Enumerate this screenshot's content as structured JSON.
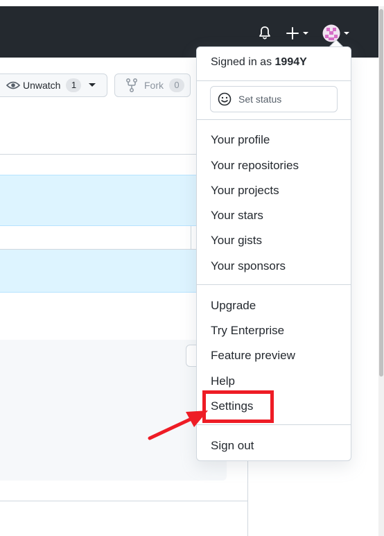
{
  "header": {
    "bell_icon": "bell-icon",
    "plus_icon": "plus-icon",
    "avatar_icon": "avatar-icon"
  },
  "repo_actions": {
    "unwatch_label": "Unwatch",
    "unwatch_count": "1",
    "fork_label": "Fork",
    "fork_count": "0"
  },
  "dropdown": {
    "signed_in_prefix": "Signed in as ",
    "username": "1994Y",
    "set_status_label": "Set status",
    "group1": [
      "Your profile",
      "Your repositories",
      "Your projects",
      "Your stars",
      "Your gists",
      "Your sponsors"
    ],
    "group2": [
      "Upgrade",
      "Try Enterprise",
      "Feature preview",
      "Help",
      "Settings"
    ],
    "sign_out_label": "Sign out"
  },
  "annotation": {
    "highlight_color": "#ee1c25",
    "highlighted_item": "Settings"
  },
  "colors": {
    "header_bg": "#24292f",
    "highlight_blue": "#ddf4ff",
    "avatar_pink": "#d66fc7"
  }
}
